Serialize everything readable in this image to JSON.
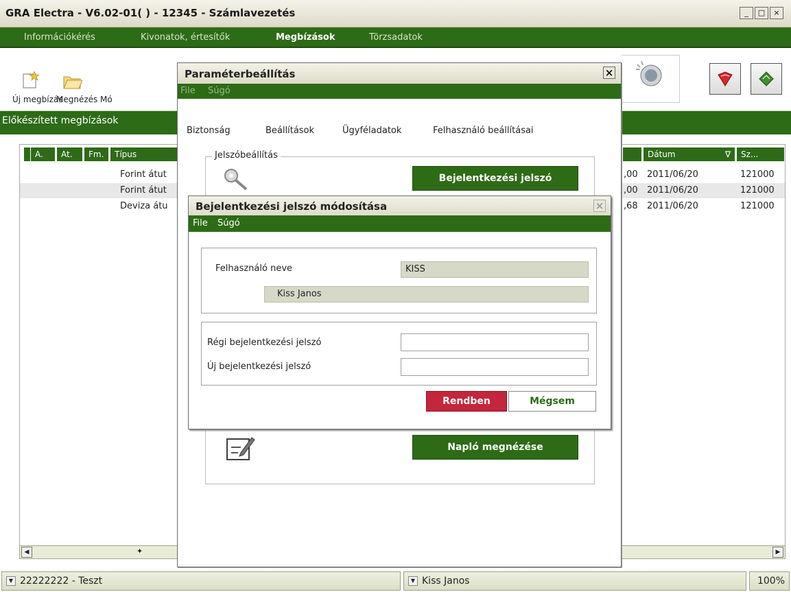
{
  "window": {
    "title": "GRA Electra - V6.02-01( ) - 12345 - Számlavezetés",
    "min_label": "_",
    "max_label": "□",
    "close_label": "×"
  },
  "menu": {
    "items": [
      "Információkérés",
      "Kivonatok, értesítők",
      "Megbízások",
      "Törzsadatok"
    ],
    "active_index": 2
  },
  "toolbar": {
    "new_label": "Új megbízás",
    "view_label": "Megnézés",
    "modify_label": "Mó"
  },
  "section": {
    "title": "Előkészített megbízások"
  },
  "grid": {
    "headers": [
      "A.",
      "At.",
      "Fm.",
      "Típus",
      "Dátum",
      "Sz..."
    ],
    "sort_indicator": "∇",
    "rows": [
      {
        "type": "Forint átut",
        "amount": ",00",
        "date": "2011/06/20",
        "num": "121000"
      },
      {
        "type": "Forint átut",
        "amount": ",00",
        "date": "2011/06/20",
        "num": "121000"
      },
      {
        "type": "Deviza átu",
        "amount": ",68",
        "date": "2011/06/20",
        "num": "121000"
      }
    ]
  },
  "status": {
    "account": "22222222 - Teszt",
    "user": "Kiss Janos",
    "zoom": "100%"
  },
  "param_dialog": {
    "title": "Paraméterbeállítás",
    "close_label": "×",
    "menu": [
      "File",
      "Súgó"
    ],
    "tabs": [
      "Biztonság",
      "Beállítások",
      "Ügyféladatok",
      "Felhasználó beállításai"
    ],
    "password_group": "Jelszóbeállítás",
    "login_password_button": "Bejelentkezési jelszó",
    "log_button": "Napló megnézése"
  },
  "pw_dialog": {
    "title": "Bejelentkezési jelszó módosítása",
    "close_label": "×",
    "menu": [
      "File",
      "Súgó"
    ],
    "username_label": "Felhasználó neve",
    "username_value": "KISS",
    "fullname_value": "Kiss Janos",
    "old_pw_label": "Régi bejelentkezési jelszó",
    "old_pw_value": "",
    "new_pw_label": "Új bejelentkezési jelszó",
    "new_pw_value": "",
    "ok_label": "Rendben",
    "cancel_label": "Mégsem"
  }
}
